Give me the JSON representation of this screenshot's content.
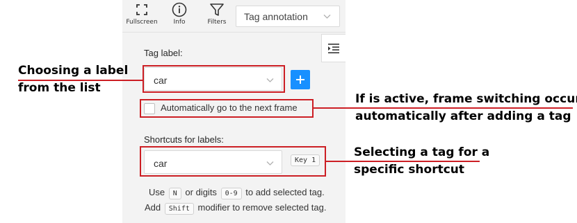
{
  "toolbar": {
    "fullscreen_label": "Fullscreen",
    "info_label": "Info",
    "filters_label": "Filters",
    "mode_value": "Tag annotation"
  },
  "tag_label": {
    "heading": "Tag label:",
    "selected": "car"
  },
  "auto_next_frame": {
    "label": "Automatically go to the next frame",
    "checked": false
  },
  "shortcuts": {
    "heading": "Shortcuts for labels:",
    "selected": "car",
    "key_badge": "Key 1"
  },
  "hints": {
    "line1_prefix": "Use",
    "line1_key": "N",
    "line1_middle": "or digits",
    "line1_digits": "0-9",
    "line1_suffix": "to add selected tag.",
    "line2_prefix": "Add",
    "line2_key": "Shift",
    "line2_suffix": "modifier to remove selected tag."
  },
  "annotations": {
    "label_choice_line1": "Choosing a label",
    "label_choice_line2": "from the list",
    "auto_line1": "If is active, frame switching occurs",
    "auto_line2": "automatically after adding a tag",
    "shortcut_line1": "Selecting a tag for a",
    "shortcut_line2": "specific shortcut"
  },
  "colors": {
    "panel_bg": "#f3f3f3",
    "accent": "#1890ff",
    "annotation_red": "#cc1e24"
  }
}
